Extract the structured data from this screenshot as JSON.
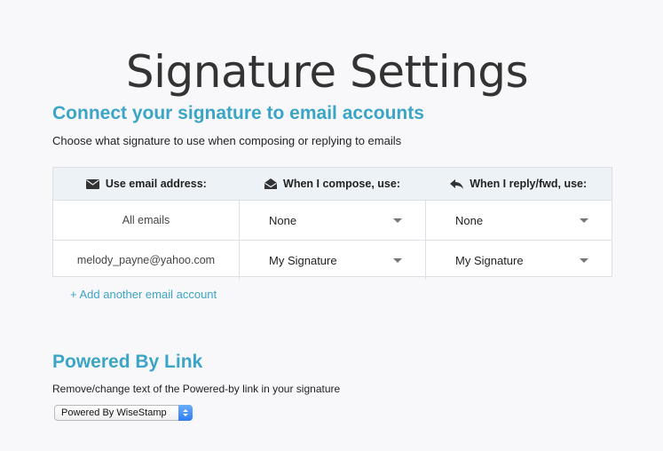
{
  "page": {
    "title": "Signature Settings"
  },
  "connect": {
    "title": "Connect your signature to email accounts",
    "description": "Choose what signature to use when composing or replying to emails",
    "columns": {
      "email": {
        "label": "Use email address:",
        "icon": "envelope-icon"
      },
      "compose": {
        "label": "When I compose, use:",
        "icon": "open-envelope-icon"
      },
      "reply": {
        "label": "When I reply/fwd, use:",
        "icon": "reply-arrow-icon"
      }
    },
    "rows": [
      {
        "email": "All emails",
        "compose": "None",
        "reply": "None"
      },
      {
        "email": "melody_payne@yahoo.com",
        "compose": "My Signature",
        "reply": "My Signature"
      }
    ],
    "add_link": "+ Add another email account"
  },
  "powered": {
    "title": "Powered By Link",
    "description": "Remove/change text of the Powered-by link in your signature",
    "select_value": "Powered By WiseStamp"
  },
  "colors": {
    "accent": "#3ba5c7",
    "header_bg": "#ecf2f5",
    "border": "#dcdfe3"
  }
}
